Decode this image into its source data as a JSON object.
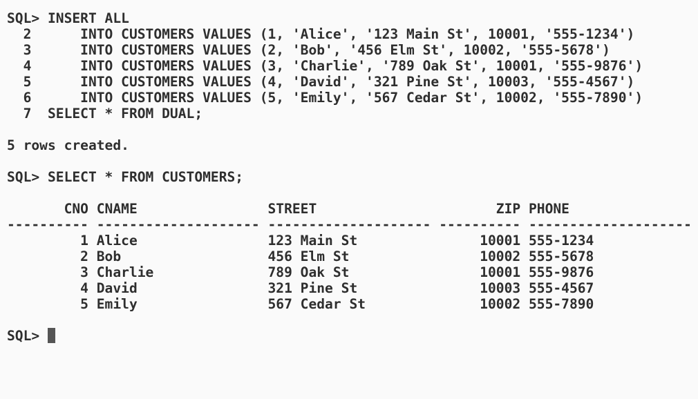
{
  "terminal": {
    "insert_block": [
      "SQL> INSERT ALL",
      "  2      INTO CUSTOMERS VALUES (1, 'Alice', '123 Main St', 10001, '555-1234')",
      "  3      INTO CUSTOMERS VALUES (2, 'Bob', '456 Elm St', 10002, '555-5678')",
      "  4      INTO CUSTOMERS VALUES (3, 'Charlie', '789 Oak St', 10001, '555-9876')",
      "  5      INTO CUSTOMERS VALUES (4, 'David', '321 Pine St', 10003, '555-4567')",
      "  6      INTO CUSTOMERS VALUES (5, 'Emily', '567 Cedar St', 10002, '555-7890')",
      "  7  SELECT * FROM DUAL;"
    ],
    "insert_result": "5 rows created.",
    "select_command": "SQL> SELECT * FROM CUSTOMERS;",
    "table_header": "       CNO CNAME                STREET                      ZIP PHONE",
    "table_separator": "---------- -------------------- -------------------- ---------- --------------------",
    "table_rows": [
      "         1 Alice                123 Main St               10001 555-1234",
      "         2 Bob                  456 Elm St                10002 555-5678",
      "         3 Charlie              789 Oak St                10001 555-9876",
      "         4 David                321 Pine St               10003 555-4567",
      "         5 Emily                567 Cedar St              10002 555-7890"
    ],
    "prompt": "SQL> "
  }
}
